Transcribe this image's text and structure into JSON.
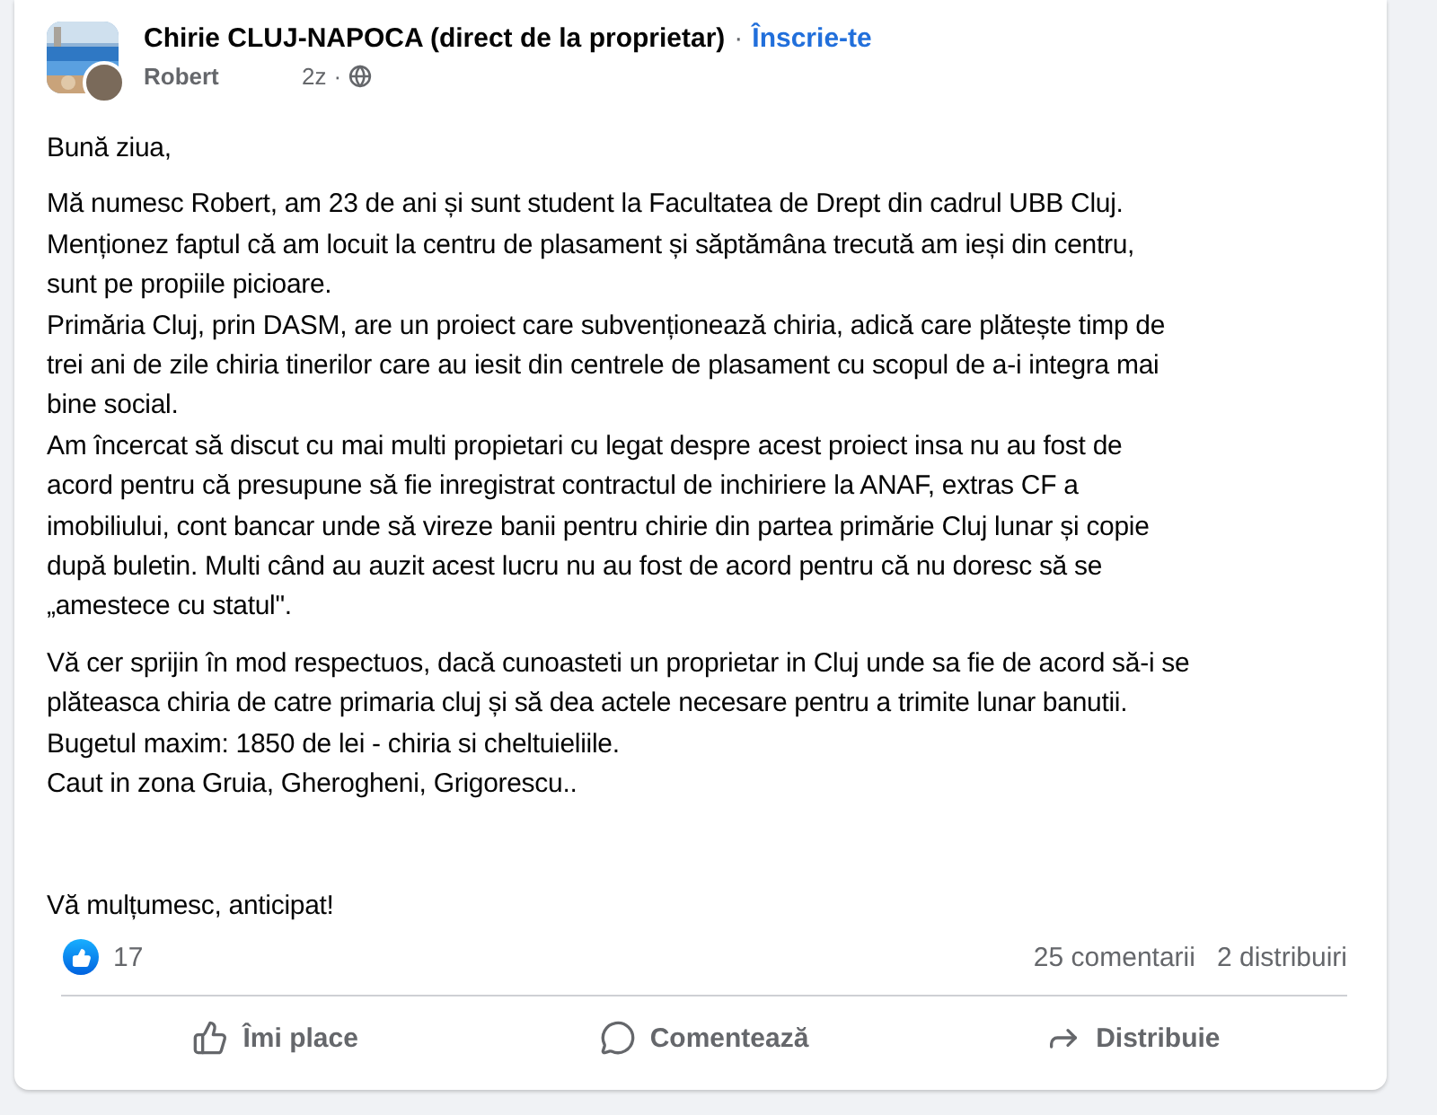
{
  "post": {
    "group": "Chirie CLUJ-NAPOCA (direct de la proprietar)",
    "separator": "·",
    "join": "Înscrie-te",
    "author": "Robert",
    "time": "2z",
    "separator2": "·"
  },
  "body": [
    {
      "lines": [
        "Bună ziua,"
      ]
    },
    {
      "lines": [
        "Mă numesc Robert, am 23 de ani și sunt student la Facultatea de Drept din cadrul UBB Cluj.",
        "Menționez faptul că am locuit la centru de plasament și săptămâna trecută am ieși din centru,",
        "sunt pe propiile picioare.",
        "Primăria Cluj, prin DASM, are un proiect care subvenționează chiria, adică care plătește timp de",
        "trei ani de zile chiria tinerilor care au iesit din centrele de plasament cu scopul de a-i integra mai",
        "bine social.",
        "Am încercat să discut cu mai multi propietari cu legat despre acest proiect insa nu au fost de",
        "acord pentru că presupune să fie inregistrat contractul de inchiriere la ANAF, extras CF a",
        "imobiliului, cont bancar unde să vireze banii pentru chirie din partea primărie Cluj lunar și  copie",
        "după buletin. Multi când au auzit acest lucru nu au fost de acord pentru că nu doresc să se",
        "„amestece cu statul\"."
      ]
    },
    {
      "lines": [
        "Vă cer sprijin în mod respectuos, dacă cunoasteti un proprietar in Cluj unde sa fie de acord să-i se",
        "plăteasca chiria de catre primaria cluj și să dea actele necesare pentru a trimite lunar banutii.",
        "Bugetul maxim: 1850 de lei - chiria si cheltuieliile.",
        "Caut in zona Gruia, Gherogheni, Grigorescu.."
      ]
    },
    {
      "lines": [
        "Vă mulțumesc, anticipat!"
      ]
    }
  ],
  "reactions": {
    "count": "17",
    "comments": "25 comentarii",
    "shares": "2 distribuiri"
  },
  "actions": [
    {
      "kind": "like",
      "label": "Îmi place"
    },
    {
      "kind": "comment",
      "label": "Comentează"
    },
    {
      "kind": "share",
      "label": "Distribuie"
    }
  ]
}
